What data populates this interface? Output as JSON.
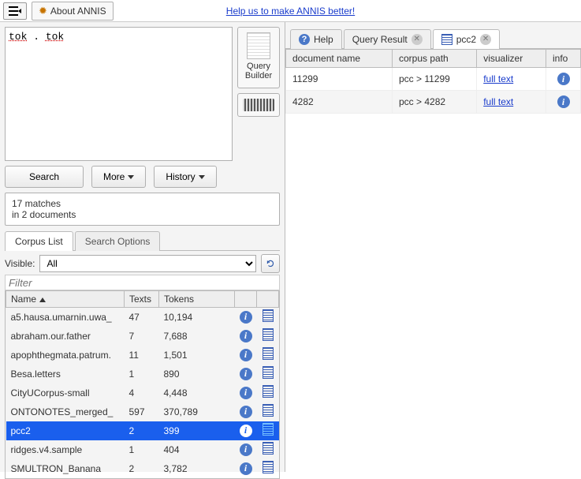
{
  "topbar": {
    "about_label": "About ANNIS",
    "help_link_text": "Help us to make ANNIS better!"
  },
  "query": {
    "text": "tok . tok",
    "query_builder_label": "Query\nBuilder"
  },
  "buttons": {
    "search": "Search",
    "more": "More",
    "history": "History"
  },
  "status": {
    "line1": "17 matches",
    "line2": "in 2 documents"
  },
  "lower_tabs": {
    "corpus_list": "Corpus List",
    "search_options": "Search Options"
  },
  "visible": {
    "label": "Visible:",
    "value": "All"
  },
  "filter_placeholder": "Filter",
  "corpus_headers": {
    "name": "Name",
    "texts": "Texts",
    "tokens": "Tokens"
  },
  "corpora": [
    {
      "name": "a5.hausa.umarnin.uwa_",
      "texts": "47",
      "tokens": "10,194",
      "selected": false
    },
    {
      "name": "abraham.our.father",
      "texts": "7",
      "tokens": "7,688",
      "selected": false
    },
    {
      "name": "apophthegmata.patrum.",
      "texts": "11",
      "tokens": "1,501",
      "selected": false
    },
    {
      "name": "Besa.letters",
      "texts": "1",
      "tokens": "890",
      "selected": false
    },
    {
      "name": "CityUCorpus-small",
      "texts": "4",
      "tokens": "4,448",
      "selected": false
    },
    {
      "name": "ONTONOTES_merged_",
      "texts": "597",
      "tokens": "370,789",
      "selected": false
    },
    {
      "name": "pcc2",
      "texts": "2",
      "tokens": "399",
      "selected": true
    },
    {
      "name": "ridges.v4.sample",
      "texts": "1",
      "tokens": "404",
      "selected": false
    },
    {
      "name": "SMULTRON_Banana",
      "texts": "2",
      "tokens": "3,782",
      "selected": false
    }
  ],
  "right_tabs": {
    "help": "Help",
    "query_result": "Query Result",
    "current": "pcc2"
  },
  "doc_headers": {
    "document_name": "document name",
    "corpus_path": "corpus path",
    "visualizer": "visualizer",
    "info": "info"
  },
  "documents": [
    {
      "name": "11299",
      "path": "pcc > 11299",
      "viz": "full text"
    },
    {
      "name": "4282",
      "path": "pcc > 4282",
      "viz": "full text"
    }
  ]
}
